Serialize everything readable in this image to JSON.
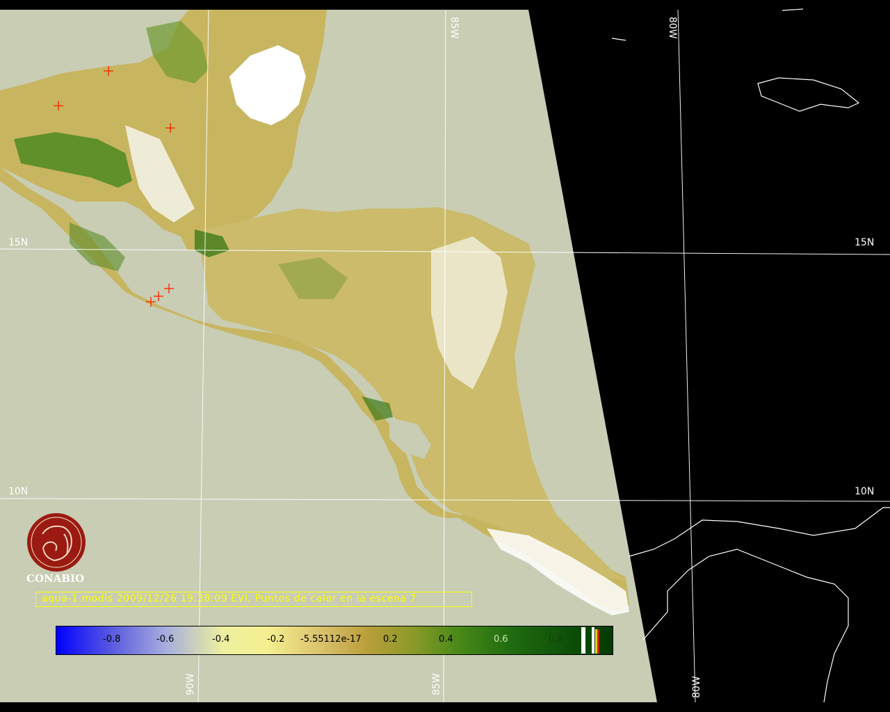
{
  "colors": {
    "ocean": "#c8cdb4",
    "outside": "#000000",
    "land": "#c9b968",
    "vegetation": "#4e8a20",
    "cloud": "#ffffff",
    "grid": "#ffffff",
    "caption": "#ffff00",
    "fire": "#ff2a00",
    "logo": "#9b1a12"
  },
  "grid_labels": {
    "lat_15_left": "15N",
    "lat_15_right": "15N",
    "lat_10_left": "10N",
    "lat_10_right": "10N",
    "lon_85_top": "85W",
    "lon_80_top": "80W",
    "lon_90_bottom": "90W",
    "lon_85_bottom": "85W",
    "lon_80_bottom": "80W"
  },
  "logo": {
    "name": "CONABIO"
  },
  "caption": "aqua-1 modis 2009/12/26 19:38:09 EVI, Puntos de calor en la escena 7",
  "colorbar": {
    "ticks": [
      "-0.8",
      "-0.6",
      "-0.4",
      "-0.2",
      "-5.55112e-17",
      "0.2",
      "0.4",
      "0.6",
      "0.8"
    ]
  },
  "hotspot_count": 7
}
